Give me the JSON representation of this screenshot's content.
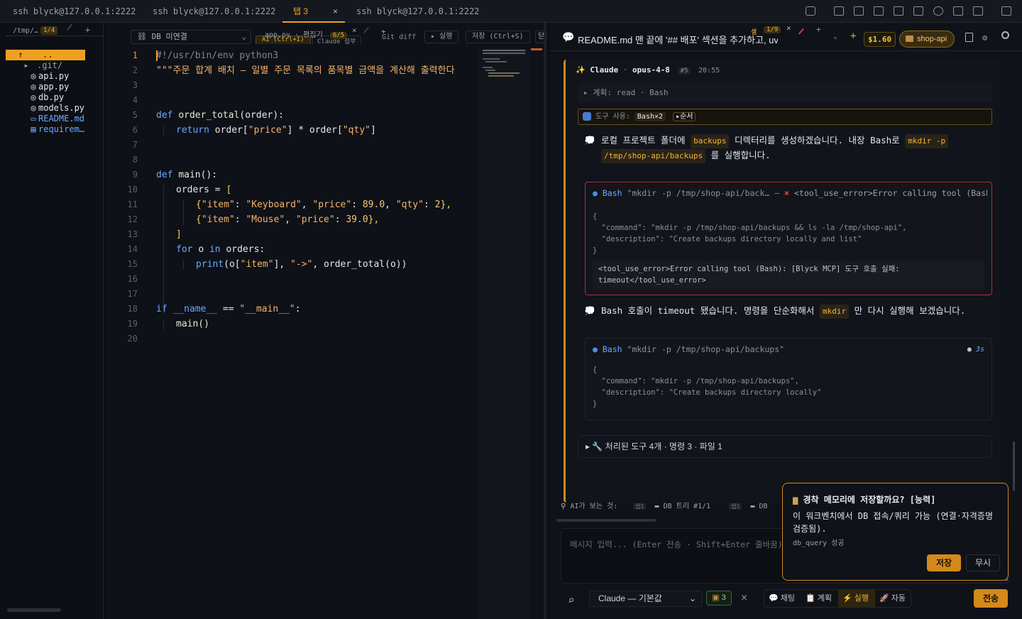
{
  "tabs": [
    {
      "label": "ssh blyck@127.0.0.1:2222"
    },
    {
      "label": "ssh blyck@127.0.0.1:2222"
    },
    {
      "label": "탭 3",
      "close": "×"
    },
    {
      "label": "ssh blyck@127.0.0.1:2222"
    }
  ],
  "left_panel": {
    "path": "/tmp/…",
    "counter": "1/4",
    "add": "+",
    "tree": [
      {
        "name": "..",
        "icon": "up-arrow-icon",
        "glyph": "↑",
        "selected": true
      },
      {
        "name": ".git/",
        "icon": "folder-icon",
        "glyph": "▸",
        "selected": false
      },
      {
        "name": "api.py",
        "icon": "python-file-icon",
        "glyph": "◎",
        "selected": false
      },
      {
        "name": "app.py",
        "icon": "python-file-icon",
        "glyph": "◎",
        "selected": false
      },
      {
        "name": "db.py",
        "icon": "python-file-icon",
        "glyph": "◎",
        "selected": false
      },
      {
        "name": "models.py",
        "icon": "python-file-icon",
        "glyph": "◎",
        "selected": false
      },
      {
        "name": "README.md",
        "icon": "markdown-file-icon",
        "glyph": "▭",
        "selected": false
      },
      {
        "name": "requirem…",
        "icon": "text-file-icon",
        "glyph": "▤",
        "selected": false
      }
    ]
  },
  "editor_toolbar": {
    "db_label": "DB 미연결",
    "file_label": "app.py · 편집기",
    "file_counter": "6/5",
    "file_close": "×",
    "file_add": "+",
    "ai_label": "AI (Ctrl+I)",
    "claude_label": "Claude 첨부",
    "gitdiff_label": "Git diff",
    "run_label": "▸ 실행",
    "save_label": "저장 (Ctrl+S)",
    "close_label": "닫"
  },
  "code_lines": [
    {
      "n": "1"
    },
    {
      "n": "2"
    },
    {
      "n": "3"
    },
    {
      "n": "4"
    },
    {
      "n": "5"
    },
    {
      "n": "6"
    },
    {
      "n": "7"
    },
    {
      "n": "8"
    },
    {
      "n": "9"
    },
    {
      "n": "10"
    },
    {
      "n": "11"
    },
    {
      "n": "12"
    },
    {
      "n": "13"
    },
    {
      "n": "14"
    },
    {
      "n": "15"
    },
    {
      "n": "16"
    },
    {
      "n": "17"
    },
    {
      "n": "18"
    },
    {
      "n": "19"
    },
    {
      "n": "20"
    }
  ],
  "code": {
    "l1": "#!/usr/bin/env python3",
    "l2": "\"\"\"주문 합계 배치 — 일별 주문 목록의 품목별 금액을 계산해 출력한다",
    "l5_kw": "def ",
    "l5_fn": "order_total",
    "l5_rest": "(order):",
    "l6_kw": "return ",
    "l6_a": "order[",
    "l6_s1": "\"price\"",
    "l6_b": "] * order[",
    "l6_s2": "\"qty\"",
    "l6_c": "]",
    "l9_kw": "def ",
    "l9_fn": "main",
    "l9_rest": "():",
    "l10_a": "orders = ",
    "l10_b": "[",
    "l11_a": "{",
    "l11_s1": "\"item\"",
    "l11_p1": ": ",
    "l11_s2": "\"Keyboard\"",
    "l11_p2": ", ",
    "l11_s3": "\"price\"",
    "l11_p3": ": ",
    "l11_n1": "89.0",
    "l11_p4": ", ",
    "l11_s4": "\"qty\"",
    "l11_p5": ": ",
    "l11_n2": "2",
    "l11_e": "},",
    "l12_a": "{",
    "l12_s1": "\"item\"",
    "l12_p1": ": ",
    "l12_s2": "\"Mouse\"",
    "l12_p2": ", ",
    "l12_s3": "\"price\"",
    "l12_p3": ": ",
    "l12_n1": "39.0",
    "l12_e": "},",
    "l13": "]",
    "l14_kw": "for ",
    "l14_a": "o ",
    "l14_kw2": "in ",
    "l14_b": "orders:",
    "l15_fn": "print",
    "l15_a": "(o[",
    "l15_s1": "\"item\"",
    "l15_b": "], ",
    "l15_s2": "\"->\"",
    "l15_c": ", order_total(o))",
    "l18_kw": "if ",
    "l18_a": "__name__",
    "l18_b": " == ",
    "l18_s": "\"__main__\"",
    "l18_c": ":",
    "l19": "main()"
  },
  "chat_header": {
    "title": "README.md 맨 끝에 '## 배포' 섹션을 추가하고, uvicorn",
    "tab_label": "셸",
    "tab_counter": "1/9",
    "close": "×",
    "add": "+",
    "cost": "$1.60",
    "project": "shop-api"
  },
  "message": {
    "author": "Claude",
    "model": "opus-4-8",
    "index": "#5",
    "time": "20:55",
    "plan": "계획: read · Bash",
    "tool_use_label": "도구 사용:",
    "tool_use_badge": "Bash×2",
    "order_label": "▸순서",
    "thought1_a": "로컬 프로젝트 폴더에 ",
    "thought1_tag1": "backups",
    "thought1_b": " 디렉터리를 생성하겠습니다. 내장 Bash로 ",
    "thought1_tag2": "mkdir -p",
    "thought1_tag3": "/tmp/shop-api/backups",
    "thought1_c": " 를 실행합니다.",
    "tool1_name": "Bash",
    "tool1_cmd": "\"mkdir -p /tmp/shop-api/back…",
    "tool1_sep": "—",
    "tool1_err": "<tool_use_error>Error calling tool (Bash)…",
    "tool1_json": "{\n  \"command\": \"mkdir -p /tmp/shop-api/backups && ls -la /tmp/shop-api\",\n  \"description\": \"Create backups directory locally and list\"\n}",
    "tool1_error_detail": "<tool_use_error>Error calling tool (Bash): [Blyck MCP] 도구 호출 실패:\ntimeout</tool_use_error>",
    "thought2_a": "Bash 호출이 timeout 됐습니다. 명령을 단순화해서 ",
    "thought2_tag": "mkdir",
    "thought2_b": " 만 다시 실행해 보겠습니다.",
    "tool2_name": "Bash",
    "tool2_cmd": "\"mkdir -p /tmp/shop-api/backups\"",
    "tool2_time": "3s",
    "tool2_json": "{\n  \"command\": \"mkdir -p /tmp/shop-api/backups\",\n  \"description\": \"Create backups directory locally\"\n}",
    "processed": "처리된 도구 4개 · 명령 3 · 파일 1"
  },
  "context_bar": {
    "label": "AI가 보는 것:",
    "chip1_tag": "탭1",
    "chip1": "DB 트리 #1/1",
    "chip2_tag": "탭1",
    "chip2": "DB"
  },
  "input": {
    "placeholder": "메시지 입력... (Enter 전송 · Shift+Enter 줄바꿈)"
  },
  "popup": {
    "title": "경착 메모리에 저장할까요? [능력]",
    "body": "이 워크벤치에서 DB 접속/쿼리 가능 (연결·자격증명 검증됨).",
    "detail": "db_query 성공",
    "save": "저장",
    "ignore": "무시"
  },
  "bottom_bar": {
    "model": "Claude — 기본값",
    "count": "3",
    "mode_chat": "채팅",
    "mode_plan": "계획",
    "mode_run": "실행",
    "mode_auto": "자동",
    "send": "전송"
  },
  "colors": {
    "accent": "#f0a020",
    "error": "#c23a4a",
    "info": "#4a90e2"
  }
}
